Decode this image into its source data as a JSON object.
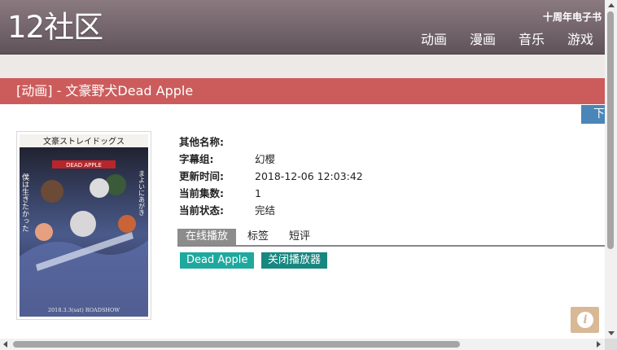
{
  "header": {
    "logo": "12社区",
    "ebook_link": "十周年电子书",
    "nav": [
      "动画",
      "漫画",
      "音乐",
      "游戏"
    ]
  },
  "title_bar": {
    "text": "[动画] - 文豪野犬Dead Apple"
  },
  "download_tab": "下",
  "poster": {
    "title_jp": "文豪ストレイドッグス",
    "subtitle": "DEAD APPLE",
    "tagline_left": "僕は生きたかった",
    "tagline_right": "まよいにあがき",
    "release": "2018.3.3(sat) ROADSHOW"
  },
  "info": [
    {
      "label": "其他名称:",
      "value": ""
    },
    {
      "label": "字幕组:",
      "value": "幻樱"
    },
    {
      "label": "更新时间:",
      "value": "2018-12-06 12:03:42"
    },
    {
      "label": "当前集数:",
      "value": "1"
    },
    {
      "label": "当前状态:",
      "value": "完结"
    }
  ],
  "tabs": [
    "在线播放",
    "标签",
    "短评"
  ],
  "buttons": {
    "episode": "Dead Apple",
    "close_player": "关闭播放器"
  },
  "colors": {
    "header": "#6f6268",
    "title_bar": "#cc5c5c",
    "download": "#4a86b8",
    "episode_button": "#1fa99e",
    "close_button": "#178780",
    "info_fab": "#d9b896"
  },
  "icons": {
    "info_fab": "info-icon"
  }
}
